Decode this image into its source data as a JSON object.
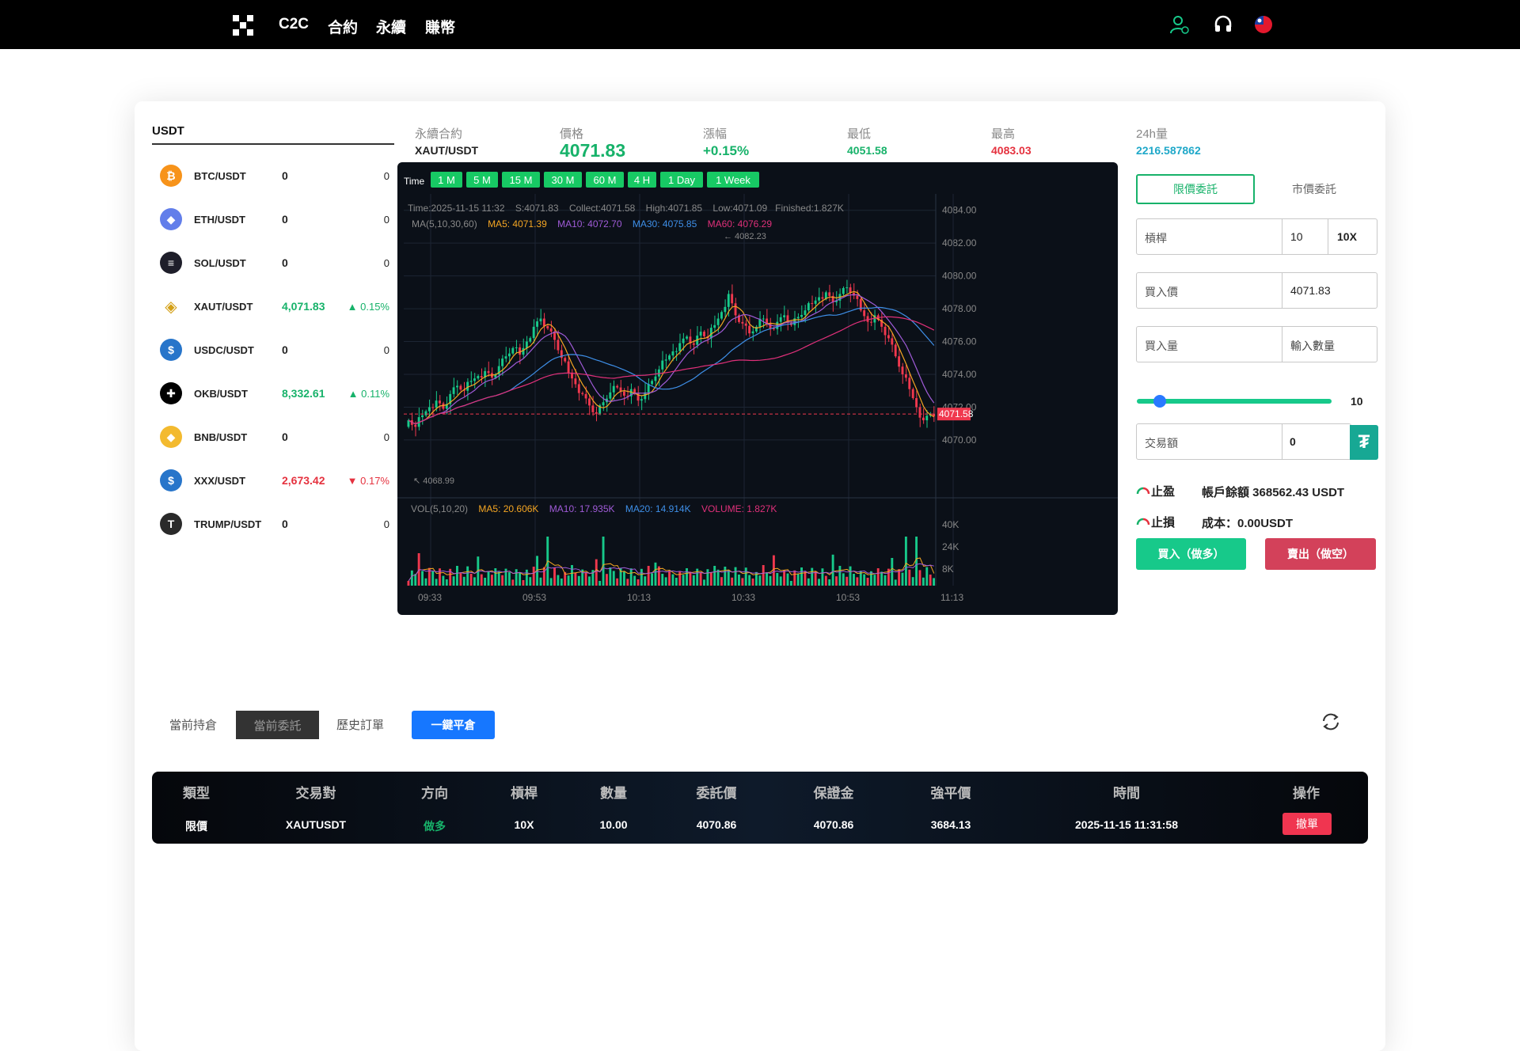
{
  "nav": {
    "items": [
      "C2C",
      "合約",
      "永續",
      "賺幣"
    ]
  },
  "colors": {
    "up": "#17b26a",
    "down": "#e5323f",
    "accent": "#17c98a",
    "blue": "#1677ff",
    "sell": "#d3415a"
  },
  "coin_list": {
    "tab": "USDT",
    "coins": [
      {
        "name": "BTC/USDT",
        "price": "0",
        "change": "0",
        "icon": "bitcoin-icon",
        "dir": "flat"
      },
      {
        "name": "ETH/USDT",
        "price": "0",
        "change": "0",
        "icon": "ethereum-icon",
        "dir": "flat"
      },
      {
        "name": "SOL/USDT",
        "price": "0",
        "change": "0",
        "icon": "solana-icon",
        "dir": "flat"
      },
      {
        "name": "XAUT/USDT",
        "price": "4,071.83",
        "change": "▲ 0.15%",
        "icon": "tether-gold-icon",
        "dir": "up"
      },
      {
        "name": "USDC/USDT",
        "price": "0",
        "change": "0",
        "icon": "usdc-icon",
        "dir": "flat"
      },
      {
        "name": "OKB/USDT",
        "price": "8,332.61",
        "change": "▲ 0.11%",
        "icon": "okb-icon",
        "dir": "up"
      },
      {
        "name": "BNB/USDT",
        "price": "0",
        "change": "0",
        "icon": "bnb-icon",
        "dir": "flat"
      },
      {
        "name": "XXX/USDT",
        "price": "2,673.42",
        "change": "▼ 0.17%",
        "icon": "xxx-coin-icon",
        "dir": "down"
      },
      {
        "name": "TRUMP/USDT",
        "price": "0",
        "change": "0",
        "icon": "trump-icon",
        "dir": "flat"
      }
    ]
  },
  "ticker": {
    "contract_label": "永續合約",
    "pair": "XAUT/USDT",
    "price_label": "價格",
    "price": "4071.83",
    "change_label": "漲幅",
    "change": "+0.15%",
    "low_label": "最低",
    "low": "4051.58",
    "high_label": "最高",
    "high": "4083.03",
    "vol_label": "24h量",
    "vol": "2216.587862"
  },
  "chart_data": {
    "type": "candlestick",
    "timeframe_label": "Time",
    "timeframes": [
      "1 M",
      "5 M",
      "15 M",
      "30 M",
      "60 M",
      "4 H",
      "1 Day",
      "1 Week"
    ],
    "info_line": {
      "time": "Time:2025-11-15 11:32",
      "start": "S:4071.83",
      "collect": "Collect:4071.58",
      "high": "High:4071.85",
      "low": "Low:4071.09",
      "finished": "Finished:1.827K"
    },
    "ma_line": {
      "label": "MA(5,10,30,60)",
      "ma5": "MA5: 4071.39",
      "ma10": "MA10: 4072.70",
      "ma30": "MA30: 4075.85",
      "ma60": "MA60: 4076.29"
    },
    "vol_line": {
      "label": "VOL(5,10,20)",
      "ma5": "MA5: 20.606K",
      "ma10": "MA10: 17.935K",
      "ma20": "MA20: 14.914K",
      "volume": "VOLUME: 1.827K"
    },
    "y_ticks": [
      "4084.00",
      "4082.00",
      "4080.00",
      "4078.00",
      "4076.00",
      "4074.00",
      "4072.00",
      "4070.00"
    ],
    "y_range": [
      4068.5,
      4085.0
    ],
    "vol_ticks": [
      "40K",
      "24K",
      "8K"
    ],
    "x_ticks": [
      "09:33",
      "09:53",
      "10:13",
      "10:33",
      "10:53",
      "11:13"
    ],
    "last_price_label": "4071.58",
    "last_price": 4071.58,
    "max_label": "4082.23",
    "min_label": "4068.99",
    "series_colors": {
      "ma5": "#f5a623",
      "ma10": "#a05bd8",
      "ma30": "#3e8fe8",
      "ma60": "#e0307a"
    },
    "close_points": [
      4071.2,
      4070.8,
      4071.5,
      4072.0,
      4072.4,
      4071.9,
      4072.8,
      4073.3,
      4073.0,
      4073.6,
      4073.9,
      4074.2,
      4073.8,
      4074.5,
      4075.1,
      4075.6,
      4075.2,
      4076.0,
      4076.9,
      4077.4,
      4076.8,
      4076.1,
      4075.0,
      4074.1,
      4073.4,
      4072.8,
      4072.1,
      4071.6,
      4072.3,
      4072.9,
      4073.2,
      4072.7,
      4073.1,
      4072.4,
      4072.9,
      4073.6,
      4074.3,
      4074.9,
      4075.4,
      4075.9,
      4076.3,
      4075.8,
      4076.6,
      4076.2,
      4077.0,
      4077.8,
      4078.9,
      4077.6,
      4077.1,
      4076.5,
      4076.9,
      4077.4,
      4076.8,
      4077.2,
      4077.6,
      4077.0,
      4077.5,
      4077.9,
      4078.3,
      4078.7,
      4079.0,
      4078.4,
      4078.9,
      4079.3,
      4078.8,
      4077.9,
      4077.2,
      4077.6,
      4076.9,
      4076.2,
      4075.1,
      4074.0,
      4073.1,
      4072.0,
      4071.2,
      4071.6
    ]
  },
  "order_panel": {
    "tab_limit": "限價委託",
    "tab_market": "市價委託",
    "leverage_label": "槓桿",
    "leverage_value": "10",
    "leverage_unit": "10X",
    "buy_price_label": "買入價",
    "buy_price": "4071.83",
    "buy_qty_label": "買入量",
    "buy_qty_placeholder": "輸入數量",
    "slider_value": "10",
    "slider_fraction": 0.1,
    "amount_label": "交易額",
    "amount_value": "0",
    "tp_label": "止盈",
    "sl_label": "止損",
    "balance": "帳戶餘額 368562.43 USDT",
    "cost": "成本：0.00USDT",
    "buy_btn": "買入（做多）",
    "sell_btn": "賣出（做空）"
  },
  "orders": {
    "tabs": [
      "當前持倉",
      "當前委託",
      "歷史訂單"
    ],
    "close_all": "一鍵平倉",
    "headers": [
      "類型",
      "交易對",
      "方向",
      "槓桿",
      "數量",
      "委託價",
      "保證金",
      "強平價",
      "時間",
      "操作"
    ],
    "rows": [
      {
        "type": "限價",
        "pair": "XAUTUSDT",
        "direction": "做多",
        "leverage": "10X",
        "qty": "10.00",
        "price": "4070.86",
        "margin": "4070.86",
        "liq": "3684.13",
        "time": "2025-11-15 11:31:58",
        "action": "撤單"
      }
    ]
  }
}
